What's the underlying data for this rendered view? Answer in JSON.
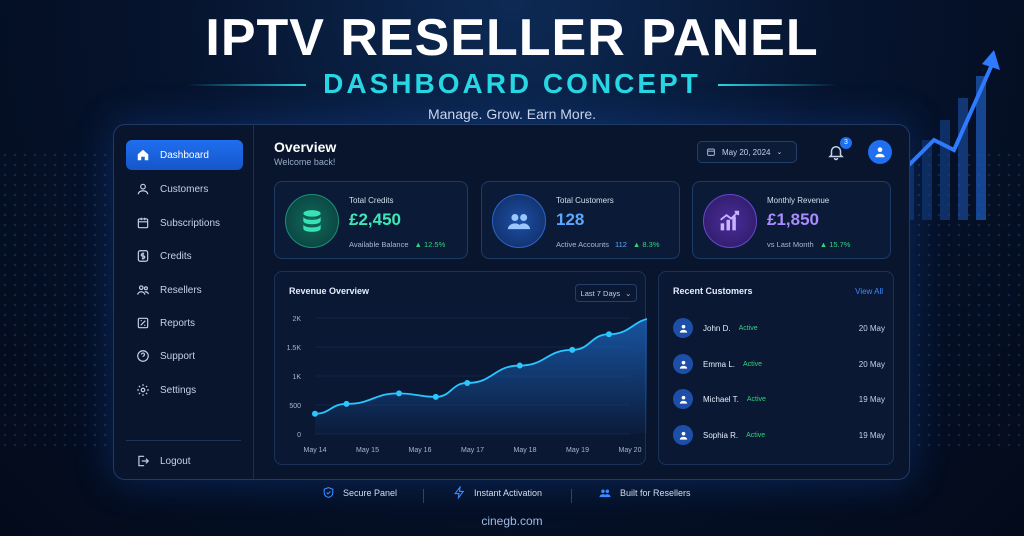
{
  "hero": {
    "title": "IPTV RESELLER PANEL",
    "subtitle": "DASHBOARD CONCEPT",
    "tagline": "Manage. Grow. Earn More."
  },
  "sidebar": {
    "items": [
      {
        "label": "Dashboard",
        "icon": "home-icon",
        "active": true
      },
      {
        "label": "Customers",
        "icon": "user-icon"
      },
      {
        "label": "Subscriptions",
        "icon": "calendar-icon"
      },
      {
        "label": "Credits",
        "icon": "dollar-icon"
      },
      {
        "label": "Resellers",
        "icon": "users-icon"
      },
      {
        "label": "Reports",
        "icon": "report-icon"
      },
      {
        "label": "Support",
        "icon": "help-icon"
      },
      {
        "label": "Settings",
        "icon": "gear-icon"
      }
    ],
    "logout": "Logout"
  },
  "header": {
    "title": "Overview",
    "welcome": "Welcome back!",
    "date": "May 20, 2024",
    "notifications": "3"
  },
  "stats": {
    "credits": {
      "label": "Total Credits",
      "value": "£2,450",
      "foot": "Available Balance",
      "delta": "▲ 12.5%"
    },
    "customers": {
      "label": "Total Customers",
      "value": "128",
      "foot": "Active Accounts",
      "extra": "112",
      "delta": "▲ 8.3%"
    },
    "revenue": {
      "label": "Monthly Revenue",
      "value": "£1,850",
      "foot": "vs Last Month",
      "delta": "▲ 15.7%"
    }
  },
  "revenue_overview": {
    "title": "Revenue Overview",
    "range": "Last 7 Days"
  },
  "chart_data": {
    "type": "area",
    "title": "Revenue Overview",
    "categories": [
      "May 14",
      "May 15",
      "May 16",
      "May 17",
      "May 18",
      "May 19",
      "May 20"
    ],
    "x_positions": [
      0,
      0.6,
      1.6,
      2.3,
      2.9,
      3.9,
      4.9,
      5.6,
      6.5
    ],
    "values": [
      350,
      520,
      700,
      640,
      880,
      1180,
      1450,
      1720,
      2000
    ],
    "y_ticks": [
      "0",
      "500",
      "1K",
      "1.5K",
      "2K"
    ],
    "ylim": [
      0,
      2000
    ],
    "colors": {
      "line": "#29c7ff",
      "fill": "#1a5fb4"
    }
  },
  "recent": {
    "title": "Recent Customers",
    "view_all": "View All",
    "rows": [
      {
        "name": "John D.",
        "status": "Active",
        "date": "20 May"
      },
      {
        "name": "Emma L.",
        "status": "Active",
        "date": "20 May"
      },
      {
        "name": "Michael T.",
        "status": "Active",
        "date": "19 May"
      },
      {
        "name": "Sophia R.",
        "status": "Active",
        "date": "19 May"
      }
    ]
  },
  "features": [
    {
      "label": "Secure Panel",
      "icon": "shield-icon"
    },
    {
      "label": "Instant Activation",
      "icon": "bolt-icon"
    },
    {
      "label": "Built for Resellers",
      "icon": "users-icon"
    }
  ],
  "footer": "cinegb.com",
  "colors": {
    "accent": "#1f6ff0",
    "cyan": "#28d7e4",
    "green": "#2fd47a",
    "purple": "#8b5cf6"
  }
}
